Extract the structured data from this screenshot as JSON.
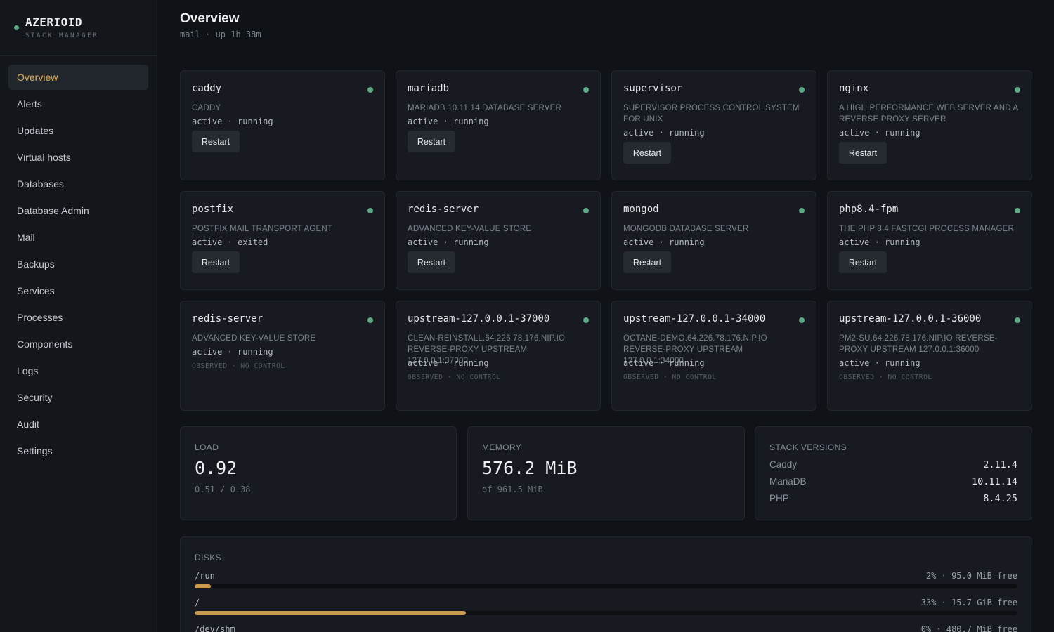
{
  "brand": {
    "name": "AZERIOID",
    "subtitle": "STACK MANAGER"
  },
  "nav": [
    "Overview",
    "Alerts",
    "Updates",
    "Virtual hosts",
    "Databases",
    "Database Admin",
    "Mail",
    "Backups",
    "Services",
    "Processes",
    "Components",
    "Logs",
    "Security",
    "Audit",
    "Settings"
  ],
  "nav_active": "Overview",
  "header": {
    "title": "Overview",
    "subtitle": "mail · up 1h 38m"
  },
  "restart_label": "Restart",
  "observed_label": "OBSERVED · NO CONTROL",
  "services": [
    {
      "name": "caddy",
      "desc": "CADDY",
      "state": "active · running",
      "controllable": true
    },
    {
      "name": "mariadb",
      "desc": "MARIADB 10.11.14 DATABASE SERVER",
      "state": "active · running",
      "controllable": true
    },
    {
      "name": "supervisor",
      "desc": "SUPERVISOR PROCESS CONTROL SYSTEM FOR UNIX",
      "state": "active · running",
      "controllable": true
    },
    {
      "name": "nginx",
      "desc": "A HIGH PERFORMANCE WEB SERVER AND A REVERSE PROXY SERVER",
      "state": "active · running",
      "controllable": true
    },
    {
      "name": "postfix",
      "desc": "POSTFIX MAIL TRANSPORT AGENT",
      "state": "active · exited",
      "controllable": true
    },
    {
      "name": "redis-server",
      "desc": "ADVANCED KEY-VALUE STORE",
      "state": "active · running",
      "controllable": true
    },
    {
      "name": "mongod",
      "desc": "MONGODB DATABASE SERVER",
      "state": "active · running",
      "controllable": true
    },
    {
      "name": "php8.4-fpm",
      "desc": "THE PHP 8.4 FASTCGI PROCESS MANAGER",
      "state": "active · running",
      "controllable": true
    },
    {
      "name": "redis-server",
      "desc": "ADVANCED KEY-VALUE STORE",
      "state": "active · running",
      "controllable": false
    },
    {
      "name": "upstream-127.0.0.1-37000",
      "desc": "CLEAN-REINSTALL.64.226.78.176.NIP.IO REVERSE-PROXY UPSTREAM 127.0.0.1:37000",
      "state": "active · running",
      "controllable": false
    },
    {
      "name": "upstream-127.0.0.1-34000",
      "desc": "OCTANE-DEMO.64.226.78.176.NIP.IO REVERSE-PROXY UPSTREAM 127.0.0.1:34000",
      "state": "active · running",
      "controllable": false
    },
    {
      "name": "upstream-127.0.0.1-36000",
      "desc": "PM2-SU.64.226.78.176.NIP.IO REVERSE-PROXY UPSTREAM 127.0.0.1:36000",
      "state": "active · running",
      "controllable": false
    }
  ],
  "load": {
    "label": "LOAD",
    "value": "0.92",
    "sub": "0.51 / 0.38"
  },
  "memory": {
    "label": "MEMORY",
    "value": "576.2 MiB",
    "sub": "of 961.5 MiB"
  },
  "versions": {
    "label": "STACK VERSIONS",
    "items": [
      {
        "name": "Caddy",
        "version": "2.11.4"
      },
      {
        "name": "MariaDB",
        "version": "10.11.14"
      },
      {
        "name": "PHP",
        "version": "8.4.25"
      }
    ]
  },
  "disks": {
    "label": "DISKS",
    "items": [
      {
        "mount": "/run",
        "info": "2% · 95.0 MiB free",
        "percent": 2
      },
      {
        "mount": "/",
        "info": "33% · 15.7 GiB free",
        "percent": 33
      },
      {
        "mount": "/dev/shm",
        "info": "0% · 480.7 MiB free",
        "percent": 0
      }
    ]
  },
  "colors": {
    "accent": "#e3b055",
    "ok": "#5ea985",
    "bar": "#c99a4e"
  }
}
